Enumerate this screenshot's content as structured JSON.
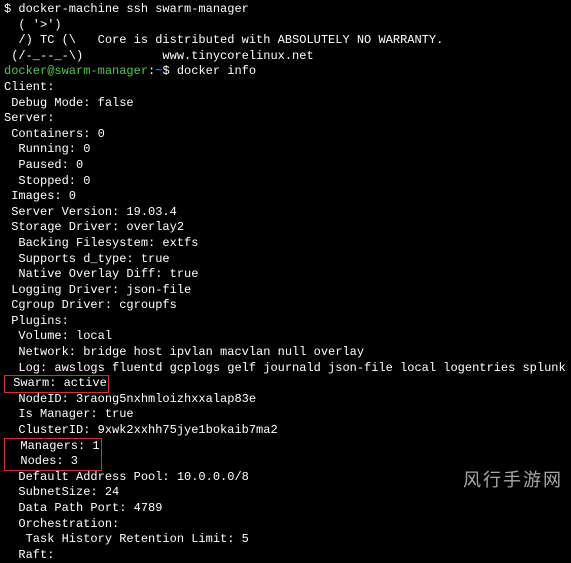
{
  "cmd1": "$ docker-machine ssh swarm-manager",
  "ascii1": "  ( '>')",
  "ascii2": "  /) TC (\\   Core is distributed with ABSOLUTELY NO WARRANTY.",
  "ascii3": " (/-_--_-\\)           www.tinycorelinux.net",
  "blank": "",
  "prompt_user": "docker@swarm-manager",
  "prompt_sep": ":",
  "prompt_path": "~",
  "prompt_end": "$ ",
  "cmd2": "docker info",
  "lines": [
    "Client:",
    " Debug Mode: false",
    "",
    "Server:",
    " Containers: 0",
    "  Running: 0",
    "  Paused: 0",
    "  Stopped: 0",
    " Images: 0",
    " Server Version: 19.03.4",
    " Storage Driver: overlay2",
    "  Backing Filesystem: extfs",
    "  Supports d_type: true",
    "  Native Overlay Diff: true",
    " Logging Driver: json-file",
    " Cgroup Driver: cgroupfs",
    " Plugins:",
    "  Volume: local",
    "  Network: bridge host ipvlan macvlan null overlay",
    "  Log: awslogs fluentd gcplogs gelf journald json-file local logentries splunk syslog"
  ],
  "swarm_line": " Swarm: active",
  "node_id": "  NodeID: 3raong5nxhmloizhxxalap83e",
  "is_manager": "  Is Manager: true",
  "cluster_id": "  ClusterID: 9xwk2xxhh75jye1bokaib7ma2",
  "managers_line": "  Managers: 1",
  "nodes_line": "  Nodes: 3",
  "tail": [
    "  Default Address Pool: 10.0.0.0/8",
    "  SubnetSize: 24",
    "  Data Path Port: 4789",
    "  Orchestration:",
    "   Task History Retention Limit: 5",
    "  Raft:"
  ],
  "watermark": "风行手游网"
}
